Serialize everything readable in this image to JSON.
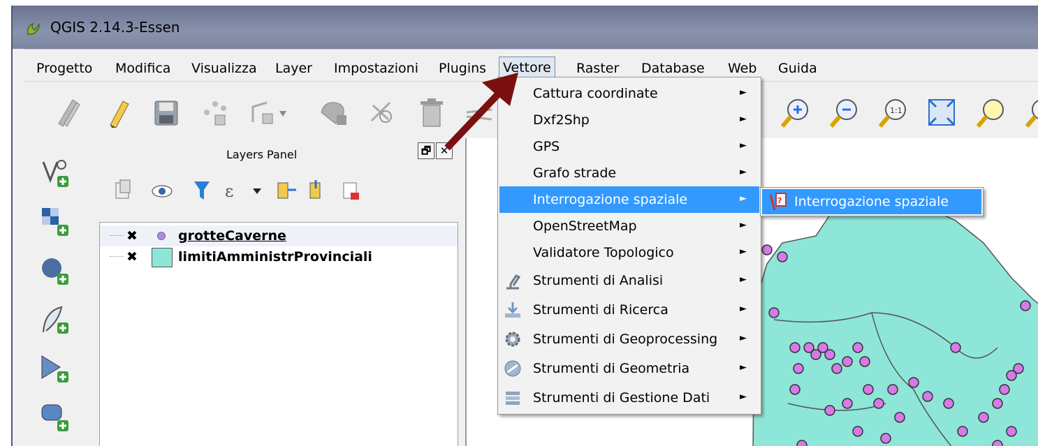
{
  "window": {
    "title": "QGIS 2.14.3-Essen"
  },
  "menubar": {
    "items": [
      {
        "label": "Progetto"
      },
      {
        "label": "Modifica"
      },
      {
        "label": "Visualizza"
      },
      {
        "label": "Layer"
      },
      {
        "label": "Impostazioni"
      },
      {
        "label": "Plugins"
      },
      {
        "label": "Vettore"
      },
      {
        "label": "Raster"
      },
      {
        "label": "Database"
      },
      {
        "label": "Web"
      },
      {
        "label": "Guida"
      }
    ],
    "active": "Vettore"
  },
  "layers_panel": {
    "title": "Layers Panel",
    "float_btn": "🗗",
    "close_btn": "✕",
    "layers": [
      {
        "name": "grotteCaverne",
        "checked_mark": "✖",
        "symbol": "point",
        "color": "#a98fd6"
      },
      {
        "name": "limitiAmministrProvinciali",
        "checked_mark": "✖",
        "symbol": "polygon",
        "color": "#8ee6d8"
      }
    ]
  },
  "vector_menu": {
    "items": [
      {
        "label": "Cattura coordinate",
        "icon": "",
        "arrow": "►"
      },
      {
        "label": "Dxf2Shp",
        "icon": "",
        "arrow": "►"
      },
      {
        "label": "GPS",
        "icon": "",
        "arrow": "►"
      },
      {
        "label": "Grafo strade",
        "icon": "",
        "arrow": "►"
      },
      {
        "label": "Interrogazione spaziale",
        "icon": "",
        "arrow": "►",
        "highlighted": true
      },
      {
        "label": "OpenStreetMap",
        "icon": "",
        "arrow": "►"
      },
      {
        "label": "Validatore Topologico",
        "icon": "",
        "arrow": "►"
      },
      {
        "label": "Strumenti di Analisi",
        "icon": "microscope-icon",
        "arrow": "►"
      },
      {
        "label": "Strumenti di Ricerca",
        "icon": "research-icon",
        "arrow": "►"
      },
      {
        "label": "Strumenti di Geoprocessing",
        "icon": "gear-icon",
        "arrow": "►"
      },
      {
        "label": "Strumenti di Geometria",
        "icon": "geometry-icon",
        "arrow": "►"
      },
      {
        "label": "Strumenti di Gestione Dati",
        "icon": "data-management-icon",
        "arrow": "►"
      }
    ]
  },
  "submenu": {
    "items": [
      {
        "label": "Interrogazione spaziale",
        "icon": "spatial-query-icon"
      }
    ]
  },
  "colors": {
    "map_polygon": "#8ee6d8",
    "map_points": "#d67ae8",
    "menu_highlight": "#3399ff",
    "annotation_arrow": "#7a1010"
  }
}
